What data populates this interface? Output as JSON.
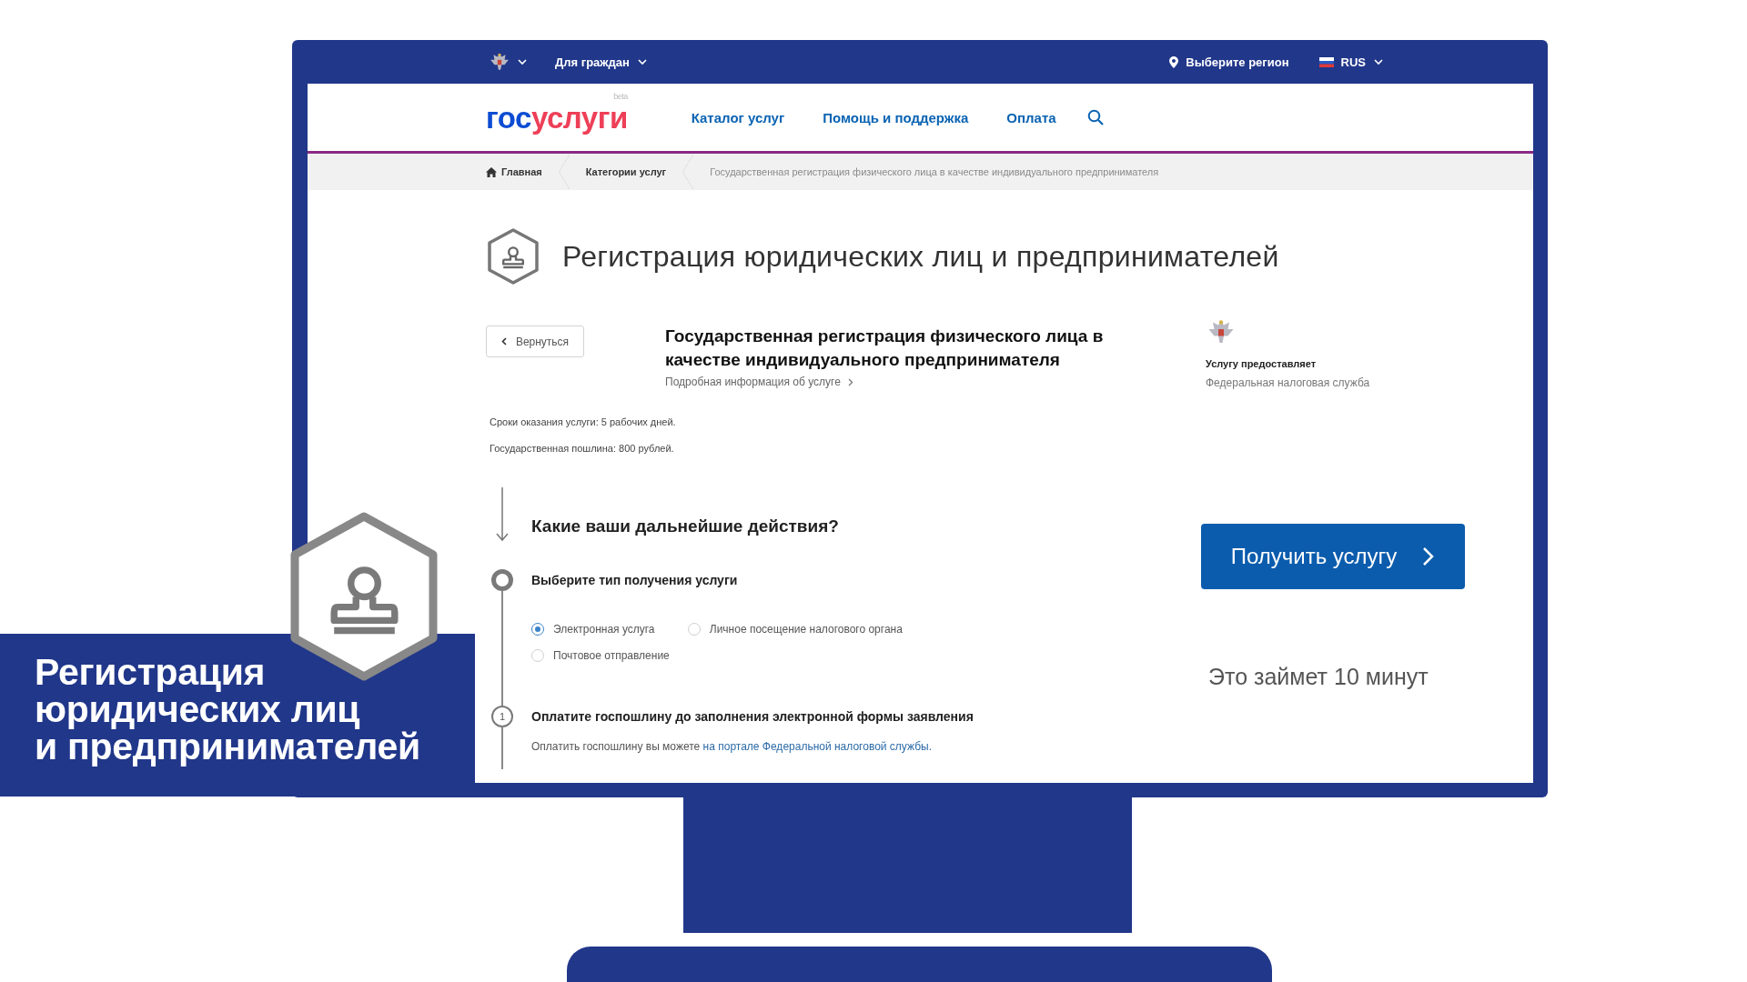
{
  "top_bar": {
    "menu": "Для граждан",
    "region": "Выберите регион",
    "language": "RUS"
  },
  "header": {
    "logo_left": "гос",
    "logo_right": "услуги",
    "logo_badge": "beta",
    "nav": [
      "Каталог услуг",
      "Помощь и поддержка",
      "Оплата"
    ]
  },
  "breadcrumbs": [
    "Главная",
    "Категории услуг",
    "Государственная регистрация физического лица в качестве индивидуального предпринимателя"
  ],
  "page_title": "Регистрация юридических лиц и предпринимателей",
  "back_button": "Вернуться",
  "service": {
    "title": "Государственная регистрация физического лица в качестве индивидуального предпринимателя",
    "details_link": "Подробная информация об услуге"
  },
  "provider": {
    "label": "Услугу предоставляет",
    "name": "Федеральная налоговая служба"
  },
  "terms": [
    "Сроки оказания услуги: 5 рабочих дней.",
    "Государственная пошлина: 800 рублей."
  ],
  "question": "Какие ваши дальнейшие действия?",
  "steps": [
    {
      "kind": "choice",
      "title": "Выберите тип получения услуги",
      "options": [
        {
          "label": "Электронная услуга",
          "selected": true
        },
        {
          "label": "Личное посещение налогового органа",
          "selected": false
        },
        {
          "label": "Почтовое отправление",
          "selected": false
        }
      ]
    },
    {
      "kind": "numbered",
      "marker": "1",
      "title": "Оплатите госпошлину до заполнения электронной формы заявления",
      "text": "Оплатить госпошлину вы можете ",
      "link": "на портале Федеральной налоговой службы."
    }
  ],
  "action_button": "Получить услугу",
  "duration": "Это займет 10 минут",
  "banner": {
    "lines": [
      "Регистрация",
      "юридических лиц",
      "и предпринимателей"
    ]
  }
}
